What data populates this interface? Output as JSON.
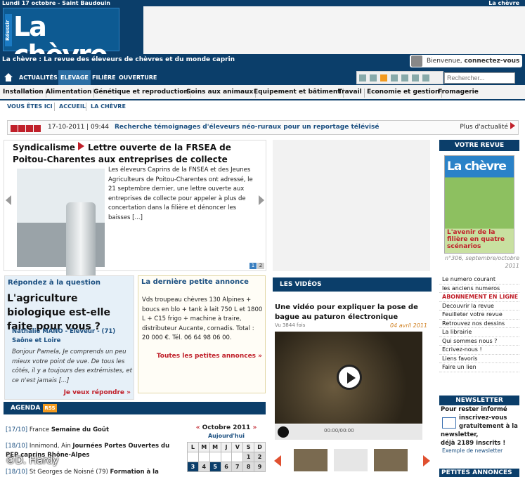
{
  "topbar": {
    "date": "Lundi 17 octobre - Saint Baudouin",
    "right": "La chèvre"
  },
  "logo": {
    "reussir": "Réussir",
    "name": "La chèvre"
  },
  "subtitle": "La chèvre : La revue des éleveurs de chèvres et du monde caprin",
  "login": {
    "text": "Bienvenue, ",
    "link": "connectez-vous"
  },
  "nav": {
    "items": [
      "ACTUALITÉS",
      "ELEVAGE",
      "FILIÈRE",
      "OUVERTURE"
    ]
  },
  "search": {
    "placeholder": "Rechercher..."
  },
  "categories": [
    "Installation",
    "Alimentation",
    "Génétique et reproduction",
    "Soins aux animaux",
    "Equipement et bâtiment",
    "Travail",
    "Economie et gestion",
    "Fromagerie"
  ],
  "breadcrumb": {
    "label": "VOUS ÊTES ICI",
    "items": [
      "ACCUEIL",
      "LA CHÈVRE"
    ]
  },
  "news": {
    "date": "17-10-2011 | 09:44",
    "text": "Recherche témoignages d'éleveurs néo-ruraux pour un reportage télévisé",
    "more": "Plus d'actualité"
  },
  "main": {
    "title_a": "Syndicalisme",
    "title_b": "Lettre ouverte de la FRSEA de Poitou-Charentes aux entreprises de collecte",
    "body": "Les éleveurs Caprins de la FNSEA et des Jeunes Agriculteurs de Poitou-Charentes ont adressé, le 21 septembre dernier, une lettre ouverte aux entreprises de collecte pour appeler à plus de concertation dans la filière et dénoncer les baisses [...]",
    "pager": [
      "1",
      "2"
    ]
  },
  "question": {
    "heading": "Répondez à la question",
    "title": "L'agriculture biologique est-elle faite pour vous ?",
    "author": "Nathalie MANO - Eleveur - (71) Saône et Loire",
    "text": "Bonjour Pamela, Je comprends un peu mieux votre point de vue. De tous les côtés, il y a toujours des extrémistes, et ce n'est jamais [...]",
    "link": "Je veux répondre »"
  },
  "annonce": {
    "heading": "La dernière petite annonce",
    "text": "Vds troupeau chèvres 130 Alpines + boucs en blo + tank à lait 750 L et 1800 L + C15 frigo + machine à traire, distributeur Aucante, cornadis. Total : 20 000 €. Tél. 06 64 98 06 00.",
    "link": "Toutes les petites annonces »"
  },
  "agenda": {
    "title": "AGENDA",
    "rss": "RSS",
    "items": [
      {
        "date": "[17/10]",
        "place": "France",
        "title": "Semaine du Goût"
      },
      {
        "date": "[18/10]",
        "place": "Innimond, Ain",
        "title": "Journées Portes Ouvertes du PEP caprins Rhône-Alpes"
      },
      {
        "date": "[18/10]",
        "place": "St Georges de Noisné (79)",
        "title": "Formation à la"
      }
    ]
  },
  "calendar": {
    "prev": "«",
    "month": "Octobre 2011",
    "next": "»",
    "today": "Aujourd'hui",
    "days": [
      "L",
      "M",
      "M",
      "J",
      "V",
      "S",
      "D"
    ],
    "row1": [
      "",
      "",
      "",
      "",
      "",
      "1",
      "2"
    ],
    "row2": [
      "3",
      "4",
      "5",
      "6",
      "7",
      "8",
      "9"
    ]
  },
  "watermark": "©D. Hardy",
  "videos": {
    "heading": "LES VIDÉOS",
    "title": "Une vidéo pour expliquer la pose de bague au paturon électronique",
    "views": "Vu 3844 fois",
    "date": "04 avril 2011",
    "time": "00:00/00:00"
  },
  "revue": {
    "heading": "VOTRE REVUE",
    "cover_title": "La chèvre",
    "cover_sub": "L'avenir de la filière en quatre scénarios",
    "issue": "n°306, septembre/octobre 2011",
    "links": [
      "Le numero courant",
      "les anciens numeros",
      "ABONNEMENT EN LIGNE",
      "Decouvrir la revue",
      "Feuilleter votre revue",
      "Retrouvez nos dessins",
      "La librairie",
      "Qui sommes nous ?",
      "Ecrivez-nous !",
      "Liens favoris",
      "Faire un lien"
    ]
  },
  "newsletter": {
    "heading": "NEWSLETTER",
    "line1": "Pour rester informé",
    "line2": "inscrivez-vous gratuitement à la",
    "line3": "newsletter,",
    "line4": "déjà 2189 inscrits !",
    "example": "Exemple de newsletter"
  },
  "petites": {
    "heading": "PETITES ANNONCES"
  }
}
